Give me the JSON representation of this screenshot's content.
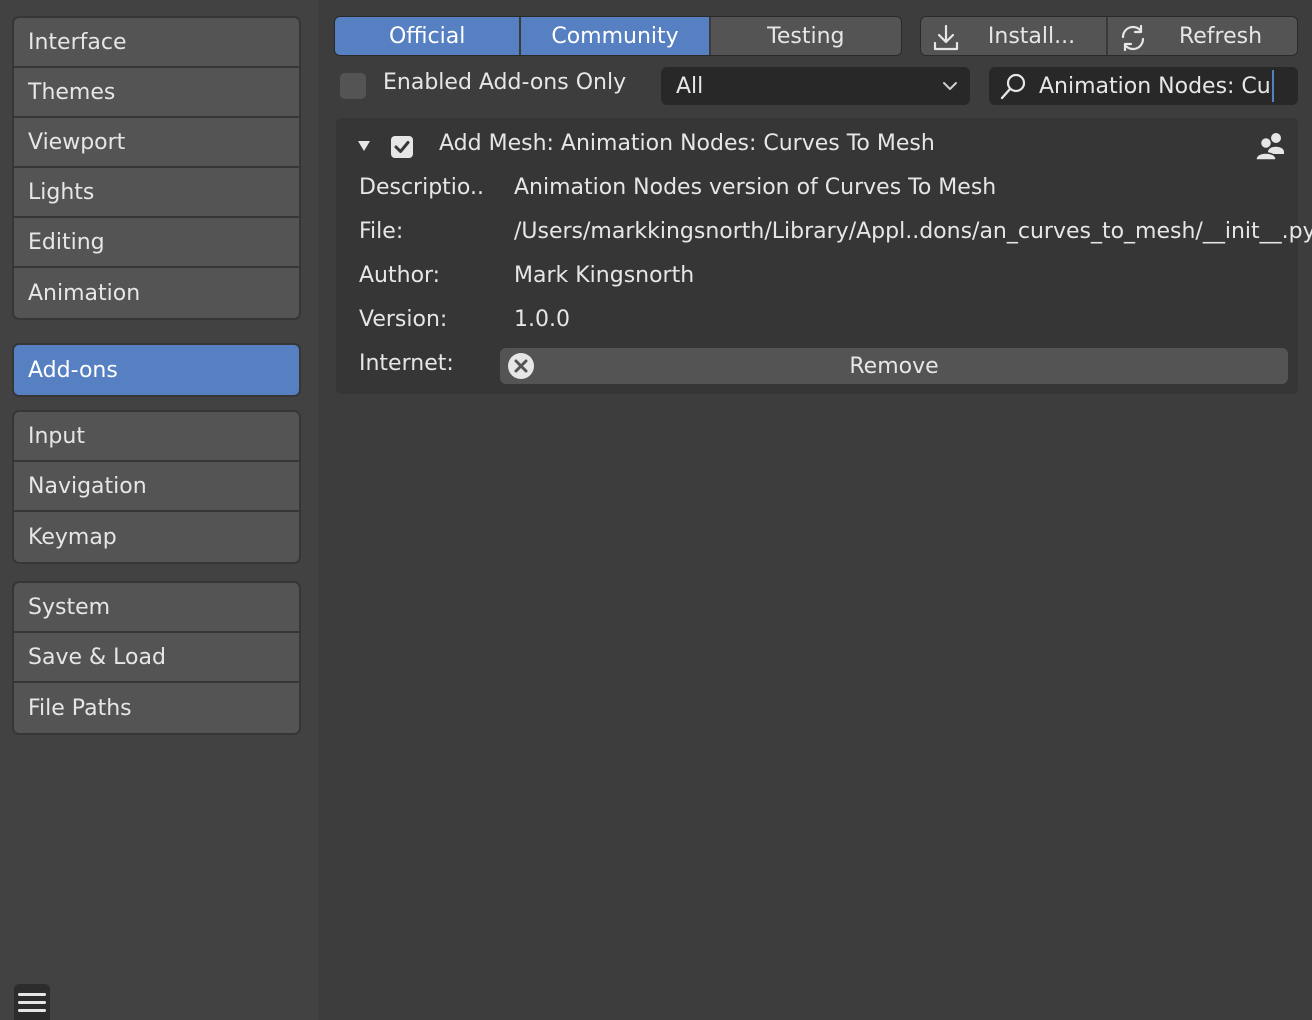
{
  "sidebar": {
    "group1": [
      "Interface",
      "Themes",
      "Viewport",
      "Lights",
      "Editing",
      "Animation"
    ],
    "group2": [
      "Add-ons"
    ],
    "group3": [
      "Input",
      "Navigation",
      "Keymap"
    ],
    "group4": [
      "System",
      "Save & Load",
      "File Paths"
    ],
    "active": "Add-ons"
  },
  "toolbar": {
    "tabs": [
      "Official",
      "Community",
      "Testing"
    ],
    "install_label": "Install...",
    "refresh_label": "Refresh"
  },
  "filters": {
    "enabled_only_label": "Enabled Add-ons Only",
    "category": "All",
    "search_value": "Animation Nodes: Cu"
  },
  "addon": {
    "title": "Add Mesh: Animation Nodes: Curves To Mesh",
    "description_label": "Descriptio..",
    "description": "Animation Nodes version of Curves To Mesh",
    "file_label": "File:",
    "file": "/Users/markkingsnorth/Library/Appl..dons/an_curves_to_mesh/__init__.py",
    "author_label": "Author:",
    "author": "Mark Kingsnorth",
    "version_label": "Version:",
    "version": "1.0.0",
    "internet_label": "Internet:",
    "remove_label": "Remove"
  },
  "colors": {
    "accent": "#5680c2",
    "background": "#3d3d3d",
    "button": "#545454"
  }
}
